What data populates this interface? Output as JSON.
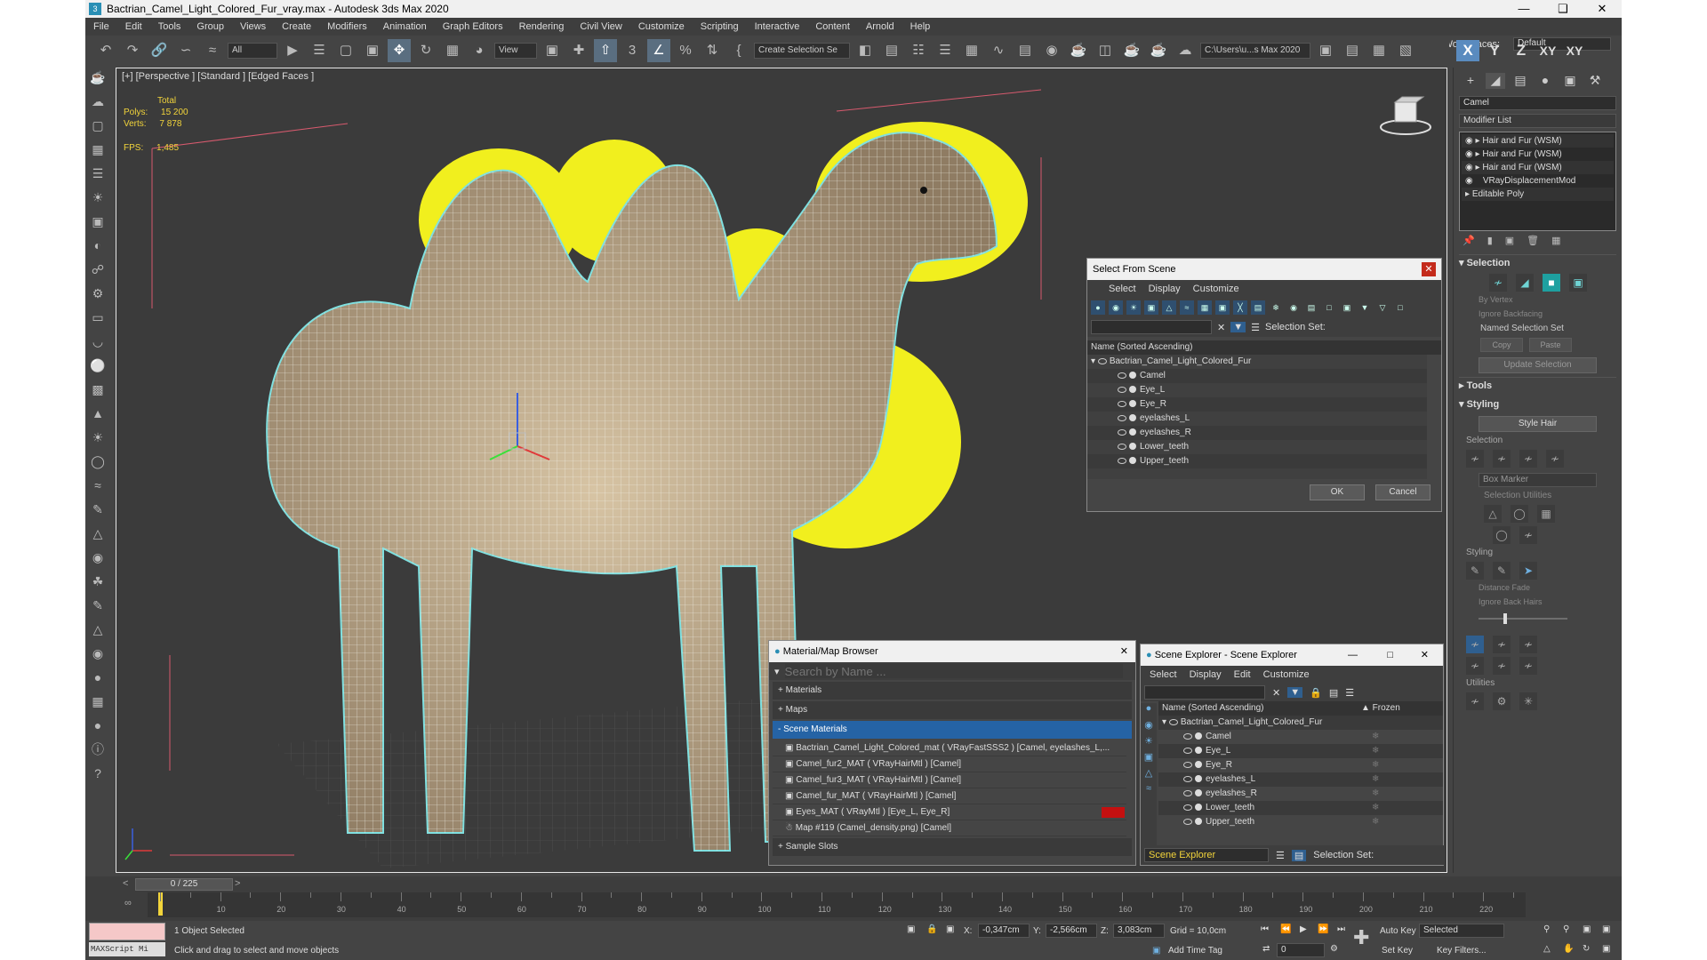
{
  "window": {
    "title": "Bactrian_Camel_Light_Colored_Fur_vray.max - Autodesk 3ds Max 2020"
  },
  "menu": [
    "File",
    "Edit",
    "Tools",
    "Group",
    "Views",
    "Create",
    "Modifiers",
    "Animation",
    "Graph Editors",
    "Rendering",
    "Civil View",
    "Customize",
    "Scripting",
    "Interactive",
    "Content",
    "Arnold",
    "Help"
  ],
  "workspace": {
    "label": "Workspaces:",
    "value": "Default"
  },
  "toolbar": {
    "filter": "All",
    "view": "View",
    "selection_set": "Create Selection Se",
    "path": "C:\\Users\\u...s Max 2020"
  },
  "axes": [
    "X",
    "Y",
    "Z",
    "XY",
    "XY"
  ],
  "viewport": {
    "label": "[+] [Perspective ] [Standard ] [Edged Faces ]",
    "stats_header": "Total",
    "polys_label": "Polys:",
    "polys": "15 200",
    "verts_label": "Verts:",
    "verts": "7 878",
    "fps_label": "FPS:",
    "fps": "1,485"
  },
  "command_panel": {
    "name": "Camel",
    "modifier_list": "Modifier List",
    "stack": [
      "Hair and Fur (WSM)",
      "Hair and Fur (WSM)",
      "Hair and Fur (WSM)",
      "VRayDisplacementMod",
      "Editable Poly"
    ],
    "selection_title": "Selection",
    "by_vertex": "By Vertex",
    "ignore_backfacing": "Ignore Backfacing",
    "named_sel": "Named Selection Set",
    "copy": "Copy",
    "paste": "Paste",
    "update_sel": "Update Selection",
    "tools_title": "Tools",
    "styling_title": "Styling",
    "style_hair": "Style Hair",
    "sub_selection": "Selection",
    "box_marker": "Box Marker",
    "sel_utils": "Selection Utilities",
    "sub_styling": "Styling",
    "distance_fade": "Distance Fade",
    "ignore_back_hairs": "Ignore Back Hairs",
    "utilities": "Utilities"
  },
  "select_from_scene": {
    "title": "Select From Scene",
    "menu": [
      "Select",
      "Display",
      "Customize"
    ],
    "selection_set": "Selection Set:",
    "column": "Name (Sorted Ascending)",
    "root": "Bactrian_Camel_Light_Colored_Fur",
    "items": [
      "Camel",
      "Eye_L",
      "Eye_R",
      "eyelashes_L",
      "eyelashes_R",
      "Lower_teeth",
      "Upper_teeth"
    ],
    "ok": "OK",
    "cancel": "Cancel"
  },
  "material_browser": {
    "title": "Material/Map Browser",
    "search": "Search by Name ...",
    "materials": "+ Materials",
    "maps": "+ Maps",
    "scene_materials": "- Scene Materials",
    "rows": [
      "Bactrian_Camel_Light_Colored_mat ( VRayFastSSS2 ) [Camel, eyelashes_L,...",
      "Camel_fur2_MAT ( VRayHairMtl ) [Camel]",
      "Camel_fur3_MAT ( VRayHairMtl ) [Camel]",
      "Camel_fur_MAT ( VRayHairMtl ) [Camel]",
      "Eyes_MAT ( VRayMtl ) [Eye_L, Eye_R]",
      "Map #119 (Camel_density.png) [Camel]"
    ],
    "sample_slots": "+ Sample Slots"
  },
  "scene_explorer": {
    "title": "Scene Explorer - Scene Explorer",
    "menu": [
      "Select",
      "Display",
      "Edit",
      "Customize"
    ],
    "column": "Name (Sorted Ascending)",
    "frozen": "▲ Frozen",
    "root": "Bactrian_Camel_Light_Colored_Fur",
    "items": [
      "Camel",
      "Eye_L",
      "Eye_R",
      "eyelashes_L",
      "eyelashes_R",
      "Lower_teeth",
      "Upper_teeth"
    ],
    "footer": "Scene Explorer",
    "selection_set": "Selection Set:"
  },
  "timeline": {
    "frame": "0 / 225",
    "ticks": [
      0,
      10,
      20,
      30,
      40,
      50,
      60,
      70,
      80,
      90,
      100,
      110,
      120,
      130,
      140,
      150,
      160,
      170,
      180,
      190,
      200,
      210,
      220
    ]
  },
  "status": {
    "selected": "1 Object Selected",
    "hint": "Click and drag to select and move objects",
    "maxscript": "MAXScript Mi",
    "x_label": "X:",
    "x": "-0,347cm",
    "y_label": "Y:",
    "y": "-2,566cm",
    "z_label": "Z:",
    "z": "3,083cm",
    "grid": "Grid = 10,0cm",
    "add_time_tag": "Add Time Tag",
    "frame_value": "0",
    "auto_key": "Auto Key",
    "set_key": "Set Key",
    "selected_dd": "Selected",
    "key_filters": "Key Filters..."
  }
}
